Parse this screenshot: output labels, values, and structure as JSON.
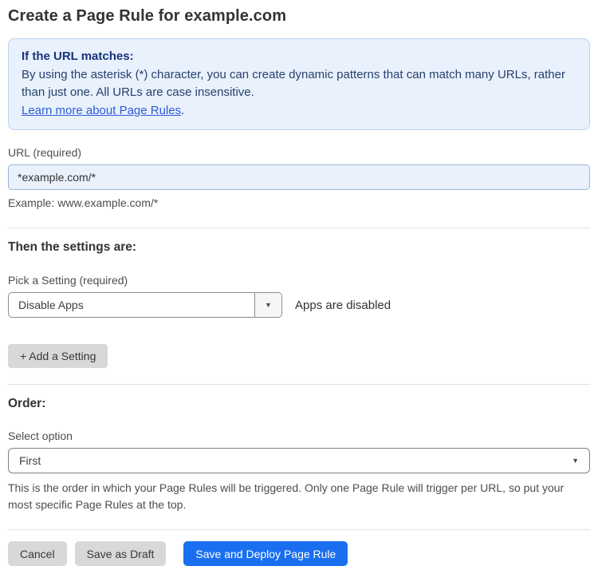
{
  "page": {
    "title": "Create a Page Rule for example.com"
  },
  "info_box": {
    "heading": "If the URL matches:",
    "body": "By using the asterisk (*) character, you can create dynamic patterns that can match many URLs, rather than just one. All URLs are case insensitive.",
    "link_label": "Learn more about Page Rules",
    "link_suffix": "."
  },
  "url_field": {
    "label": "URL (required)",
    "value": "*example.com/*",
    "helper": "Example: www.example.com/*"
  },
  "settings_section": {
    "heading": "Then the settings are:",
    "picker_label": "Pick a Setting (required)",
    "selected_setting": "Disable Apps",
    "status_text": "Apps are disabled",
    "add_setting_label": "+ Add a Setting"
  },
  "order_section": {
    "heading": "Order:",
    "select_label": "Select option",
    "selected_option": "First",
    "helper": "This is the order in which your Page Rules will be triggered. Only one Page Rule will trigger per URL, so put your most specific Page Rules at the top."
  },
  "actions": {
    "cancel": "Cancel",
    "save_draft": "Save as Draft",
    "save_deploy": "Save and Deploy Page Rule"
  },
  "icons": {
    "chevron_down": "▼"
  },
  "colors": {
    "primary_button": "#196ff0",
    "gray_button": "#d8d8d8",
    "info_background": "#e8f1fc",
    "info_border": "#b9d3f0",
    "info_text": "#27406f",
    "link": "#2d5bd7",
    "input_background": "#e9f1fd",
    "input_border": "#9db4d4"
  }
}
